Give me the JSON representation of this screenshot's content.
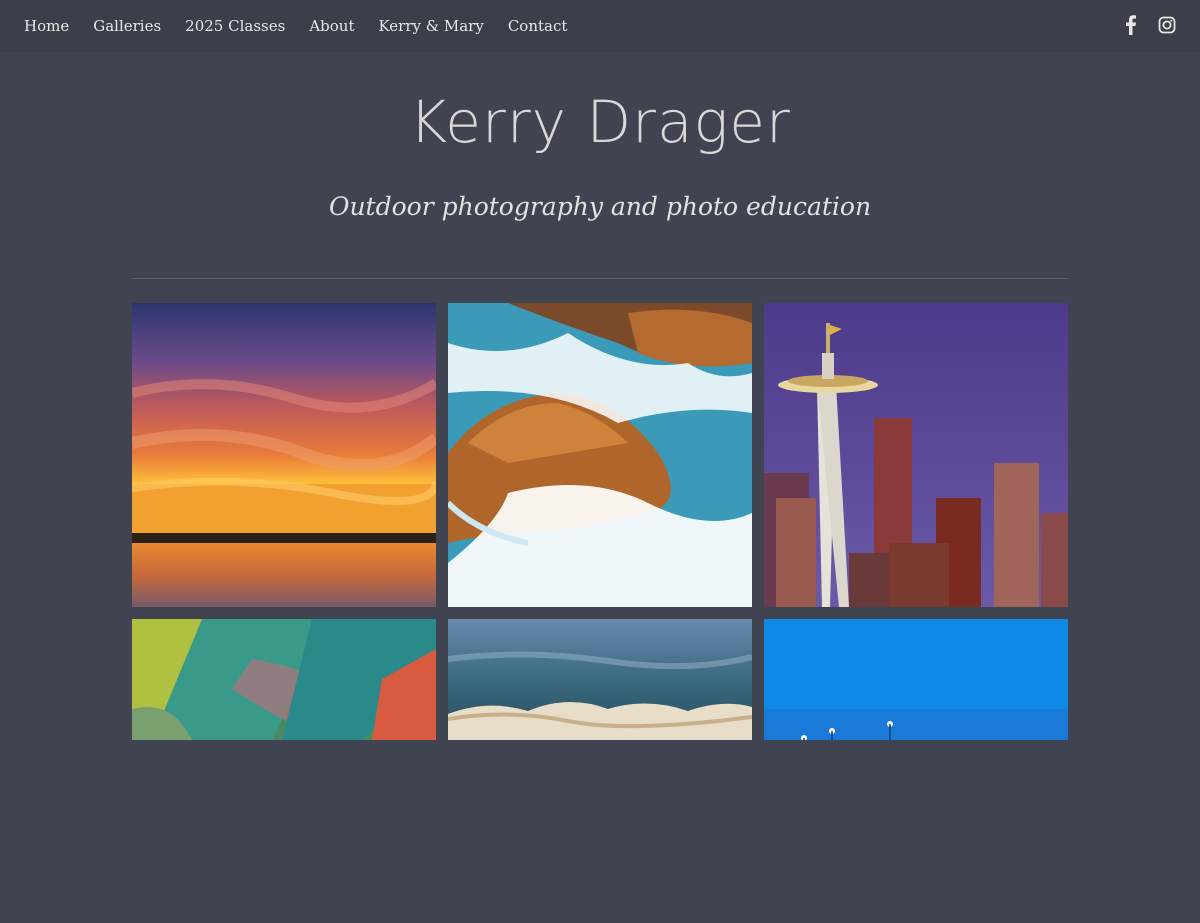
{
  "nav": {
    "items": [
      "Home",
      "Galleries",
      "2025 Classes",
      "About",
      "Kerry & Mary",
      "Contact"
    ]
  },
  "social": {
    "icons": [
      "facebook-icon",
      "instagram-icon"
    ]
  },
  "site": {
    "title": "Kerry Drager",
    "tagline": "Outdoor photography and photo education"
  },
  "colors": {
    "background": "#3f4450",
    "topbar": "#3a3f4a",
    "text": "#e6e6e6"
  },
  "gallery": {
    "photos": [
      "sunset-reflection",
      "ocean-wave-rocks",
      "seattle-space-needle",
      "painted-rope-closeup",
      "breaking-wave",
      "blue-hour-lights"
    ]
  }
}
